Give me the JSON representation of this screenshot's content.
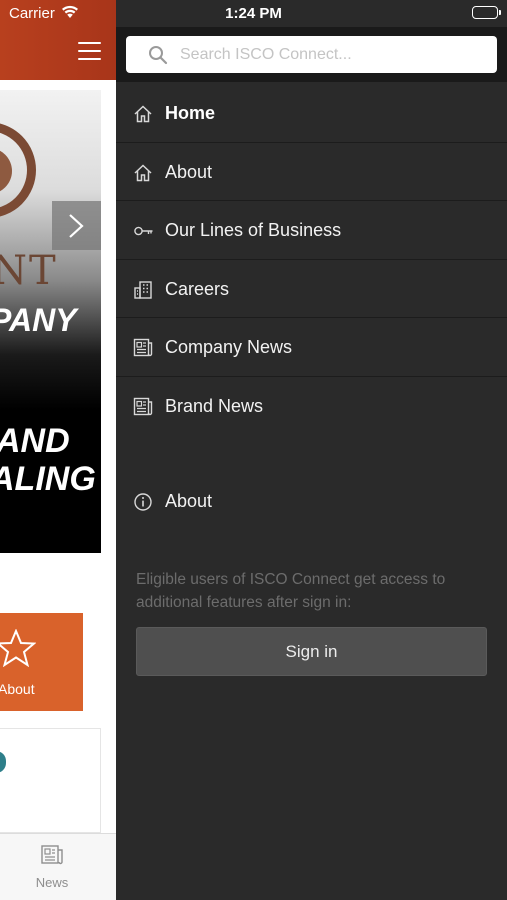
{
  "status_bar": {
    "carrier": "Carrier",
    "time": "1:24 PM"
  },
  "background_app": {
    "header_color": "#b33c1c",
    "banner_words": [
      "NT",
      "NY",
      "PANY",
      "AND",
      "ALING"
    ],
    "about_tile_label": "About",
    "about_tile_color": "#d9622b",
    "tab_news_label": "News"
  },
  "menu": {
    "search": {
      "placeholder": "Search ISCO Connect..."
    },
    "items": [
      {
        "label": "Home",
        "icon": "home-icon",
        "active": true
      },
      {
        "label": "About",
        "icon": "home-icon",
        "active": false
      },
      {
        "label": "Our Lines of Business",
        "icon": "key-icon",
        "active": false
      },
      {
        "label": "Careers",
        "icon": "building-icon",
        "active": false
      },
      {
        "label": "Company News",
        "icon": "newspaper-icon",
        "active": false
      },
      {
        "label": "Brand News",
        "icon": "newspaper-icon",
        "active": false
      }
    ],
    "about_link": {
      "label": "About",
      "icon": "info-icon"
    },
    "signin_note": "Eligible users of ISCO Connect get access to additional features after sign in:",
    "signin_button": "Sign in",
    "background_color": "#2a2a2a"
  }
}
